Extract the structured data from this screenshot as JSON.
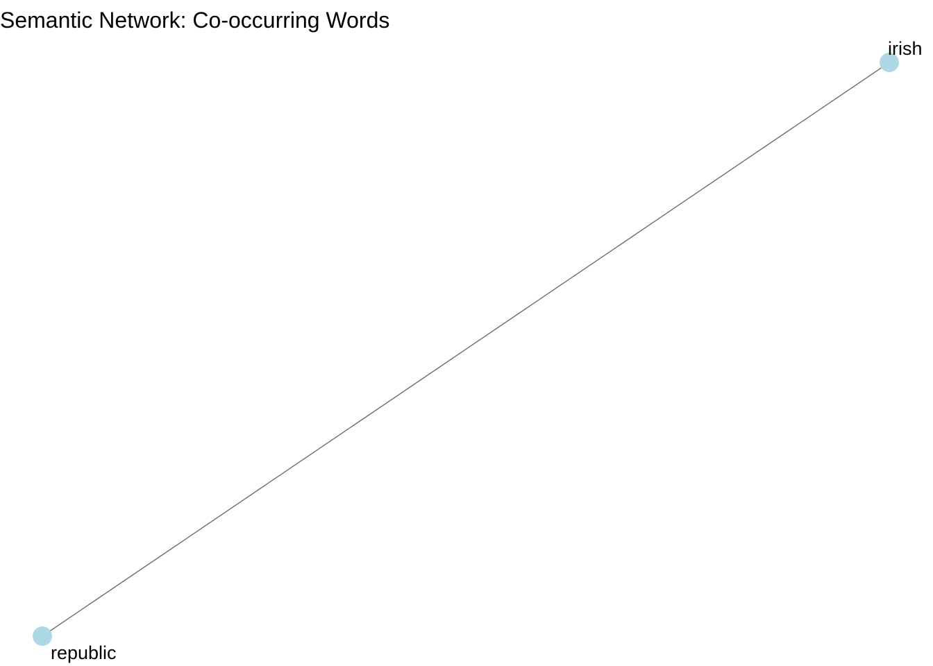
{
  "title": "Semantic Network: Co-occurring Words",
  "network": {
    "nodes": [
      {
        "id": "irish",
        "label": "irish"
      },
      {
        "id": "republic",
        "label": "republic"
      }
    ],
    "edges": [
      {
        "source": "irish",
        "target": "republic"
      }
    ]
  },
  "colors": {
    "node_fill": "#add8e6",
    "edge_stroke": "#6e6e6e",
    "label_text": "#000000",
    "background": "#ffffff"
  }
}
